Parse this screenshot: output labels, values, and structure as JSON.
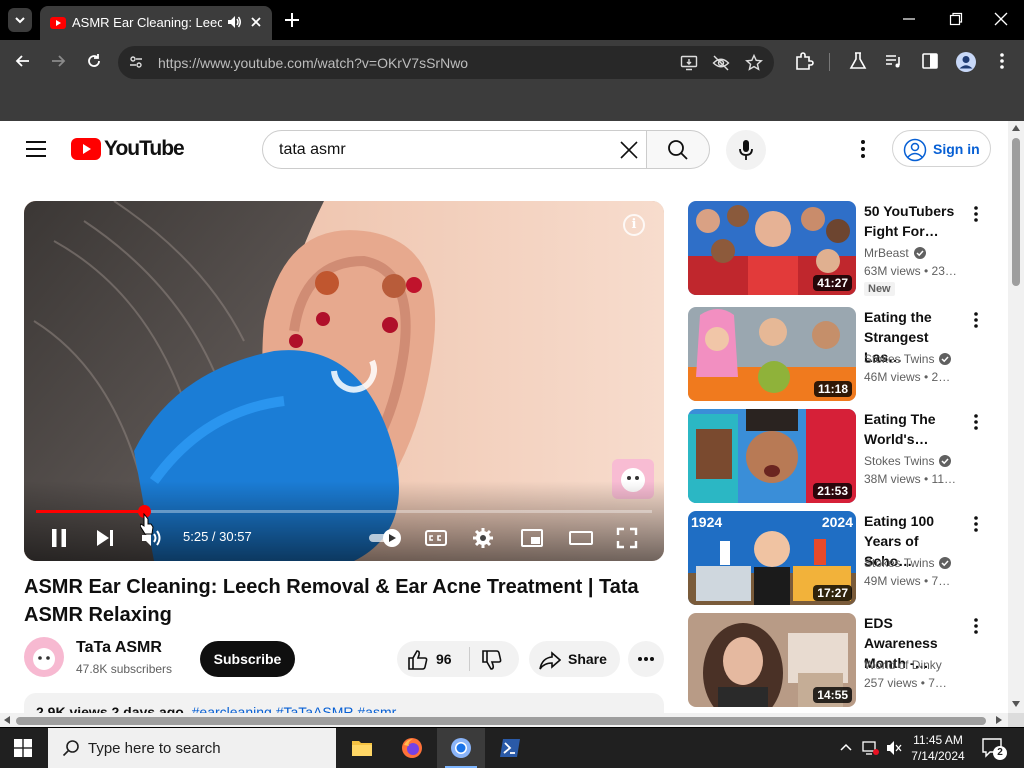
{
  "browser": {
    "tab_title": "ASMR Ear Cleaning: Leech",
    "url_host": "https://www.youtube.com",
    "url_path": "/watch?v=OKrV7sSrNwo"
  },
  "header": {
    "logo_text": "YouTube",
    "search_value": "tata asmr",
    "signin_label": "Sign in"
  },
  "player": {
    "time": "5:25 / 30:57",
    "progress_fraction": 0.175,
    "info_label": "i"
  },
  "video": {
    "title": "ASMR Ear Cleaning: Leech Removal & Ear Acne Treatment | Tata ASMR Relaxing",
    "channel": "TaTa ASMR",
    "subscribers": "47.8K subscribers",
    "subscribe_label": "Subscribe",
    "likes": "96",
    "share_label": "Share",
    "description_stats": "2.9K views  2 days ago",
    "description_tags": "#earcleaning #TaTaASMR #asmr"
  },
  "recommendations": [
    {
      "title": "50 YouTubers Fight For…",
      "channel": "MrBeast",
      "meta": "63M views • 23…",
      "duration": "41:27",
      "badge": "New",
      "verified": true
    },
    {
      "title": "Eating the Strangest Las…",
      "channel": "Stokes Twins",
      "meta": "46M views • 2…",
      "duration": "11:18",
      "verified": true
    },
    {
      "title": "Eating The World's…",
      "channel": "Stokes Twins",
      "meta": "38M views • 11…",
      "duration": "21:53",
      "verified": true
    },
    {
      "title": "Eating 100 Years of Scho…",
      "channel": "Stokes Twins",
      "meta": "49M views • 7…",
      "duration": "17:27",
      "verified": true
    },
    {
      "title": "EDS Awareness Month -…",
      "channel": "World of Dinky",
      "meta": "257 views • 7…",
      "duration": "14:55",
      "verified": false
    }
  ],
  "thumb_text": {
    "left": "1924",
    "right": "2024"
  },
  "taskbar": {
    "search_placeholder": "Type here to search",
    "time": "11:45 AM",
    "date": "7/14/2024",
    "notification_count": "2"
  },
  "colors": {
    "accent_red": "#ff0000",
    "link_blue": "#065fd4"
  }
}
